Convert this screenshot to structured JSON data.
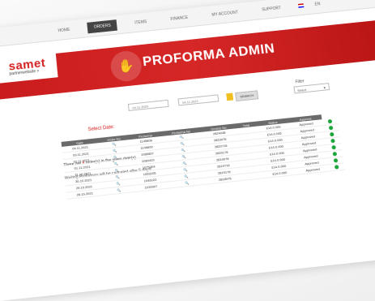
{
  "nav": {
    "items": [
      "Home",
      "Orders",
      "Items",
      "Finance",
      "My Account",
      "Support"
    ],
    "active_index": 1,
    "language": "EN"
  },
  "logo": {
    "brand": "samet",
    "sub": "partnerwebsite >"
  },
  "banner": {
    "title": "PROFORMA ADMIN"
  },
  "filters": {
    "select_date_label": "Select Date:",
    "date_from": "04.11.2020",
    "date_to": "04.11.2021",
    "search_label": "SEARCH",
    "filter_label": "Filter",
    "filter_value": "Select"
  },
  "notice": {
    "prefix": "There are ",
    "count": "8",
    "suffix": " order(s) in the given date(s).",
    "line2": "Waiting Proformas will be canceled after 5 days!"
  },
  "table": {
    "headers": [
      "Date",
      "Order No",
      "Proforma",
      "Proforma No",
      "Invoice No",
      "Total",
      "Status",
      "Approve"
    ],
    "rows": [
      [
        "04.11.2021",
        "",
        "1145608",
        "",
        "2824048",
        "",
        "£14.0.000",
        "Approved"
      ],
      [
        "03.11.2021",
        "",
        "1145600",
        "",
        "2823976",
        "",
        "£14.0.000",
        "Approved"
      ],
      [
        "02.11.2021",
        "",
        "1085807",
        "",
        "2820716",
        "",
        "£14.0.000",
        "Approved"
      ],
      [
        "01.11.2021",
        "",
        "1080410",
        "",
        "2820176",
        "",
        "£14.0.000",
        "Approved"
      ],
      [
        "31.10.2021",
        "",
        "1075204",
        "",
        "2819976",
        "",
        "£14.0.000",
        "Approved"
      ],
      [
        "30.10.2021",
        "",
        "1053105",
        "",
        "2819716",
        "",
        "£14.0.000",
        "Approved"
      ],
      [
        "29.10.2021",
        "",
        "1046102",
        "",
        "2819176",
        "",
        "£14.0.000",
        "Approved"
      ],
      [
        "28.10.2021",
        "",
        "1032007",
        "",
        "2818976",
        "",
        "£14.0.000",
        "Approved"
      ]
    ]
  },
  "colors": {
    "brand": "#d42020",
    "status_ok": "#1ca53a"
  },
  "icons": {
    "mail": "mail-icon",
    "power": "power-icon",
    "search": "magnifier-icon",
    "calendar": "calendar-icon"
  }
}
